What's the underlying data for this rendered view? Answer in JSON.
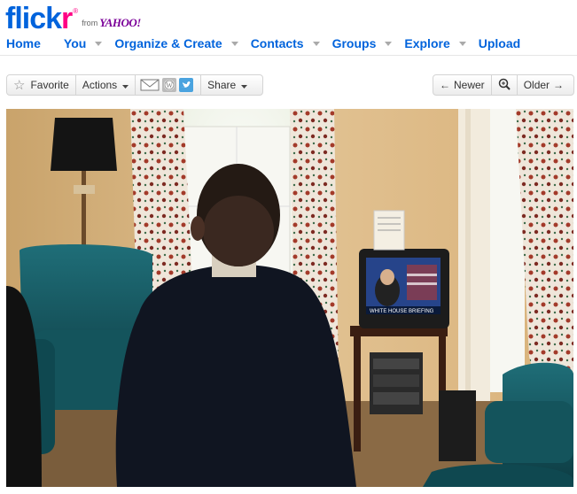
{
  "brand": {
    "logo_left": "flick",
    "logo_right": "r",
    "registered": "®",
    "from_text": "from",
    "yahoo_text": "YAHOO!"
  },
  "nav": {
    "items": [
      {
        "label": "Home",
        "has_menu": false
      },
      {
        "label": "You",
        "has_menu": true
      },
      {
        "label": "Organize & Create",
        "has_menu": true
      },
      {
        "label": "Contacts",
        "has_menu": true
      },
      {
        "label": "Groups",
        "has_menu": true
      },
      {
        "label": "Explore",
        "has_menu": true
      },
      {
        "label": "Upload",
        "has_menu": false
      }
    ]
  },
  "toolbar": {
    "favorite_label": "Favorite",
    "actions_label": "Actions",
    "share_label": "Share",
    "newer_label": "Newer",
    "older_label": "Older",
    "icons": [
      "star-icon",
      "email-icon",
      "wordpress-icon",
      "twitter-icon",
      "zoom-icon"
    ]
  },
  "photo": {
    "tv_caption": "WHITE HOUSE BRIEFING"
  },
  "colors": {
    "brand_blue": "#0063dc",
    "brand_pink": "#ff0084",
    "yahoo_purple": "#7b0099"
  }
}
